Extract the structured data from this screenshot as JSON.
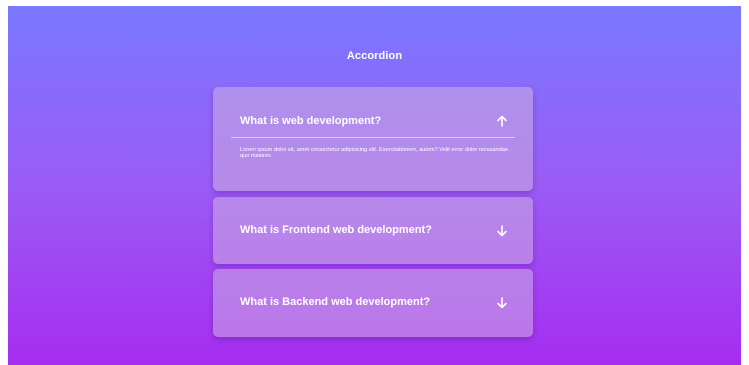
{
  "page": {
    "title": "Accordion"
  },
  "accordion": {
    "items": [
      {
        "question": "What is web development?",
        "answer": "Lorem ipsum dolor sit, amet consectetur adipisicing elit. Exercitationem, autem? Velit error dolor recusandae quo maiores",
        "expanded": true,
        "icon": "arrow-up-icon"
      },
      {
        "question": "What is Frontend web development?",
        "expanded": false,
        "icon": "arrow-down-icon"
      },
      {
        "question": "What is Backend web development?",
        "expanded": false,
        "icon": "arrow-down-icon"
      }
    ]
  },
  "colors": {
    "gradient_top": "#7a78ff",
    "gradient_bottom": "#a62df0",
    "text": "#ffffff"
  }
}
